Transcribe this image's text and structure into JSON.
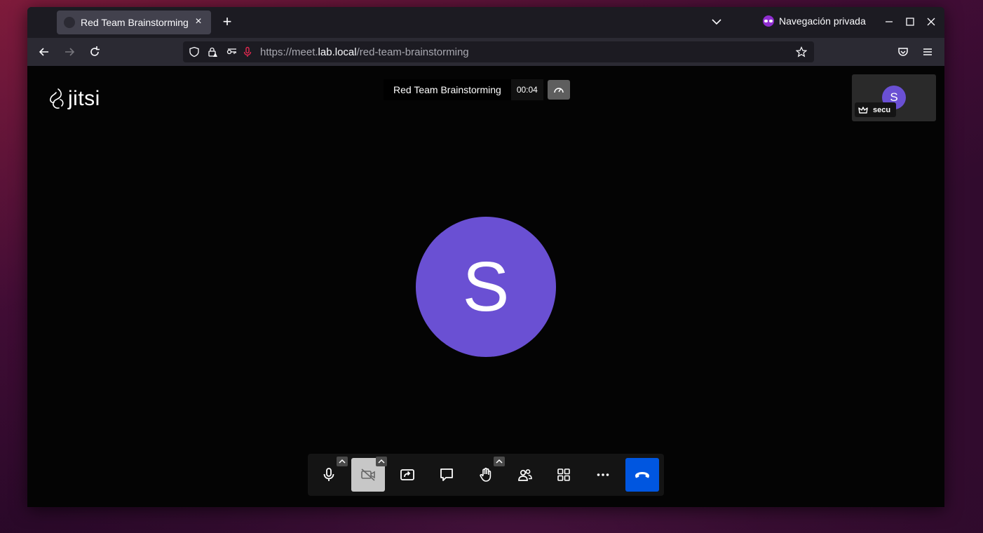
{
  "browser": {
    "tab_title": "Red Team Brainstorming",
    "tab_close": "×",
    "new_tab": "+",
    "private_label": "Navegación privada",
    "url_prefix": "https://meet.",
    "url_host": "lab.local",
    "url_path": "/red-team-brainstorming"
  },
  "meeting": {
    "subject": "Red Team Brainstorming",
    "timer": "00:04",
    "logo_text": "jitsi",
    "main_avatar_initial": "S",
    "thumbnail_avatar_initial": "S",
    "participant_name": "secu"
  },
  "toolbar": {
    "buttons": [
      "microphone",
      "camera",
      "share-screen",
      "chat",
      "raise-hand",
      "participants",
      "tile-view",
      "more",
      "hangup"
    ]
  },
  "colors": {
    "avatar": "#6a50d3",
    "hangup": "#0056e0",
    "camera_muted_bg": "#c7c7c7"
  }
}
